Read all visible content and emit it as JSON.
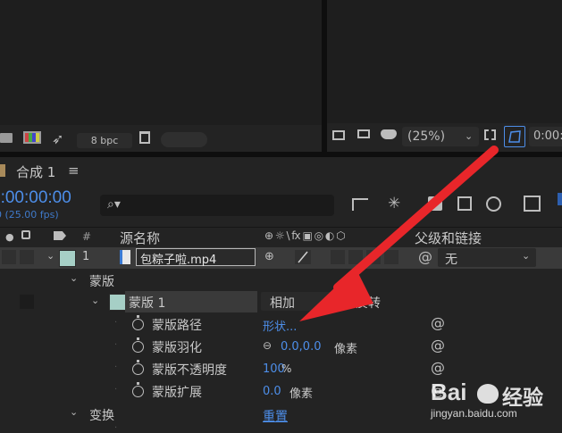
{
  "top": {
    "bpc": "8 bpc",
    "zoom": "(25%)",
    "timecode_fragment": "0:00:"
  },
  "comp": {
    "tab_title": "合成 1",
    "timecode": "0:00:00:00",
    "fps": "0 (25.00 fps)",
    "search_placeholder": "⌕▾"
  },
  "columns": {
    "number": "#",
    "source_name": "源名称",
    "switches": "⊕ ☼ \\ fx ▣ ◎ ◐ ⬡",
    "parent": "父级和链接"
  },
  "layer": {
    "index": "1",
    "name": "包粽子啦.mp4",
    "parent_value": "无"
  },
  "masks": {
    "group_label": "蒙版",
    "mask_name": "蒙版 1",
    "mode": "相加",
    "invert_label": "反转",
    "properties": [
      {
        "label": "蒙版路径",
        "value": "形状...",
        "unit": ""
      },
      {
        "label": "蒙版羽化",
        "value": "0.0,0.0",
        "unit": "像素"
      },
      {
        "label": "蒙版不透明度",
        "value": "100",
        "unit": "%"
      },
      {
        "label": "蒙版扩展",
        "value": "0.0",
        "unit": "像素"
      }
    ]
  },
  "transform": {
    "label": "变换",
    "reset": "重置"
  },
  "watermark": {
    "brand": "Bai",
    "brand2": "经验",
    "url": "jingyan.baidu.com"
  },
  "colors": {
    "accent_blue": "#4d8ee9",
    "label_cyan": "#a6cfc6",
    "arrow_red": "#e8262a"
  }
}
